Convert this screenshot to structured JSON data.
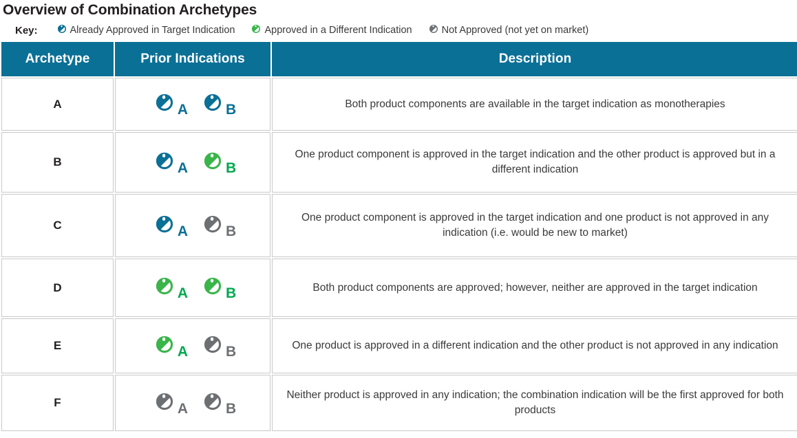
{
  "title": "Overview of Combination Archetypes",
  "colors": {
    "blue": "#0B7096",
    "green": "#39B54A",
    "green_letter": "#00A94F",
    "gray": "#6D7073",
    "header_bg": "#0B7096",
    "archetype_cell_bg": "#dcdedc"
  },
  "key": {
    "label": "Key:",
    "items": [
      {
        "icon": "pill-icon-blue",
        "color": "blue",
        "text": "Already Approved in Target Indication"
      },
      {
        "icon": "pill-icon-green",
        "color": "green",
        "text": "Approved in a Different Indication"
      },
      {
        "icon": "pill-icon-gray",
        "color": "gray",
        "text": "Not Approved (not yet on market)"
      }
    ]
  },
  "table": {
    "columns": [
      "Archetype",
      "Prior Indications",
      "Description"
    ],
    "rows": [
      {
        "archetype": "A",
        "pills": [
          {
            "letter": "A",
            "color": "blue"
          },
          {
            "letter": "B",
            "color": "blue"
          }
        ],
        "description": "Both product components are available in the target indication as monotherapies"
      },
      {
        "archetype": "B",
        "pills": [
          {
            "letter": "A",
            "color": "blue"
          },
          {
            "letter": "B",
            "color": "green"
          }
        ],
        "description": "One product component is approved in the target indication and the other product is approved but in a different indication"
      },
      {
        "archetype": "C",
        "pills": [
          {
            "letter": "A",
            "color": "blue"
          },
          {
            "letter": "B",
            "color": "gray"
          }
        ],
        "description": "One product component is approved in the target indication and one product is not approved in any indication (i.e. would be new to market)"
      },
      {
        "archetype": "D",
        "pills": [
          {
            "letter": "A",
            "color": "green"
          },
          {
            "letter": "B",
            "color": "green"
          }
        ],
        "description": "Both product components are approved; however, neither are approved in the target indication"
      },
      {
        "archetype": "E",
        "pills": [
          {
            "letter": "A",
            "color": "green"
          },
          {
            "letter": "B",
            "color": "gray"
          }
        ],
        "description": "One product is approved in a different indication and the other product is not approved in any indication"
      },
      {
        "archetype": "F",
        "pills": [
          {
            "letter": "A",
            "color": "gray"
          },
          {
            "letter": "B",
            "color": "gray"
          }
        ],
        "description": "Neither product is approved in any indication; the combination indication will be the first approved for both products"
      }
    ]
  }
}
